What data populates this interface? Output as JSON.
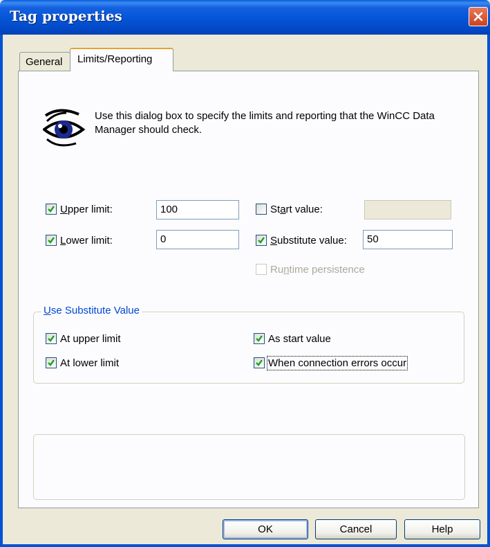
{
  "window": {
    "title": "Tag properties"
  },
  "tabs": [
    {
      "label": "General"
    },
    {
      "label": "Limits/Reporting"
    }
  ],
  "description": "Use this dialog box to specify the limits and reporting that the WinCC Data Manager should check.",
  "limits": {
    "upper": {
      "pre": "U",
      "rest": "pper limit:",
      "checked": true,
      "value": "100"
    },
    "lower": {
      "pre": "L",
      "rest": "ower limit:",
      "checked": true,
      "value": "0"
    },
    "start": {
      "pre": "St",
      "acc": "a",
      "rest": "rt value:",
      "checked": false,
      "value": ""
    },
    "substitute": {
      "pre": "S",
      "rest": "ubstitute value:",
      "checked": true,
      "value": "50"
    },
    "persistence": {
      "pre": "Ru",
      "acc": "n",
      "rest": "time persistence",
      "checked": false,
      "enabled": false
    }
  },
  "substitute_group": {
    "title_acc": "U",
    "title_rest": "se Substitute Value",
    "options": [
      {
        "label": "At upper limit",
        "checked": true
      },
      {
        "label": "As start value",
        "checked": true
      },
      {
        "label": "At lower limit",
        "checked": true
      },
      {
        "label": "When connection errors occur",
        "checked": true
      }
    ]
  },
  "buttons": {
    "ok": "OK",
    "cancel": "Cancel",
    "help": "Help"
  },
  "colors": {
    "title_bar": "#0454D6",
    "dialog_bg": "#ECE9D8",
    "tab_accent": "#E8A22E",
    "group_title": "#0046D5"
  }
}
